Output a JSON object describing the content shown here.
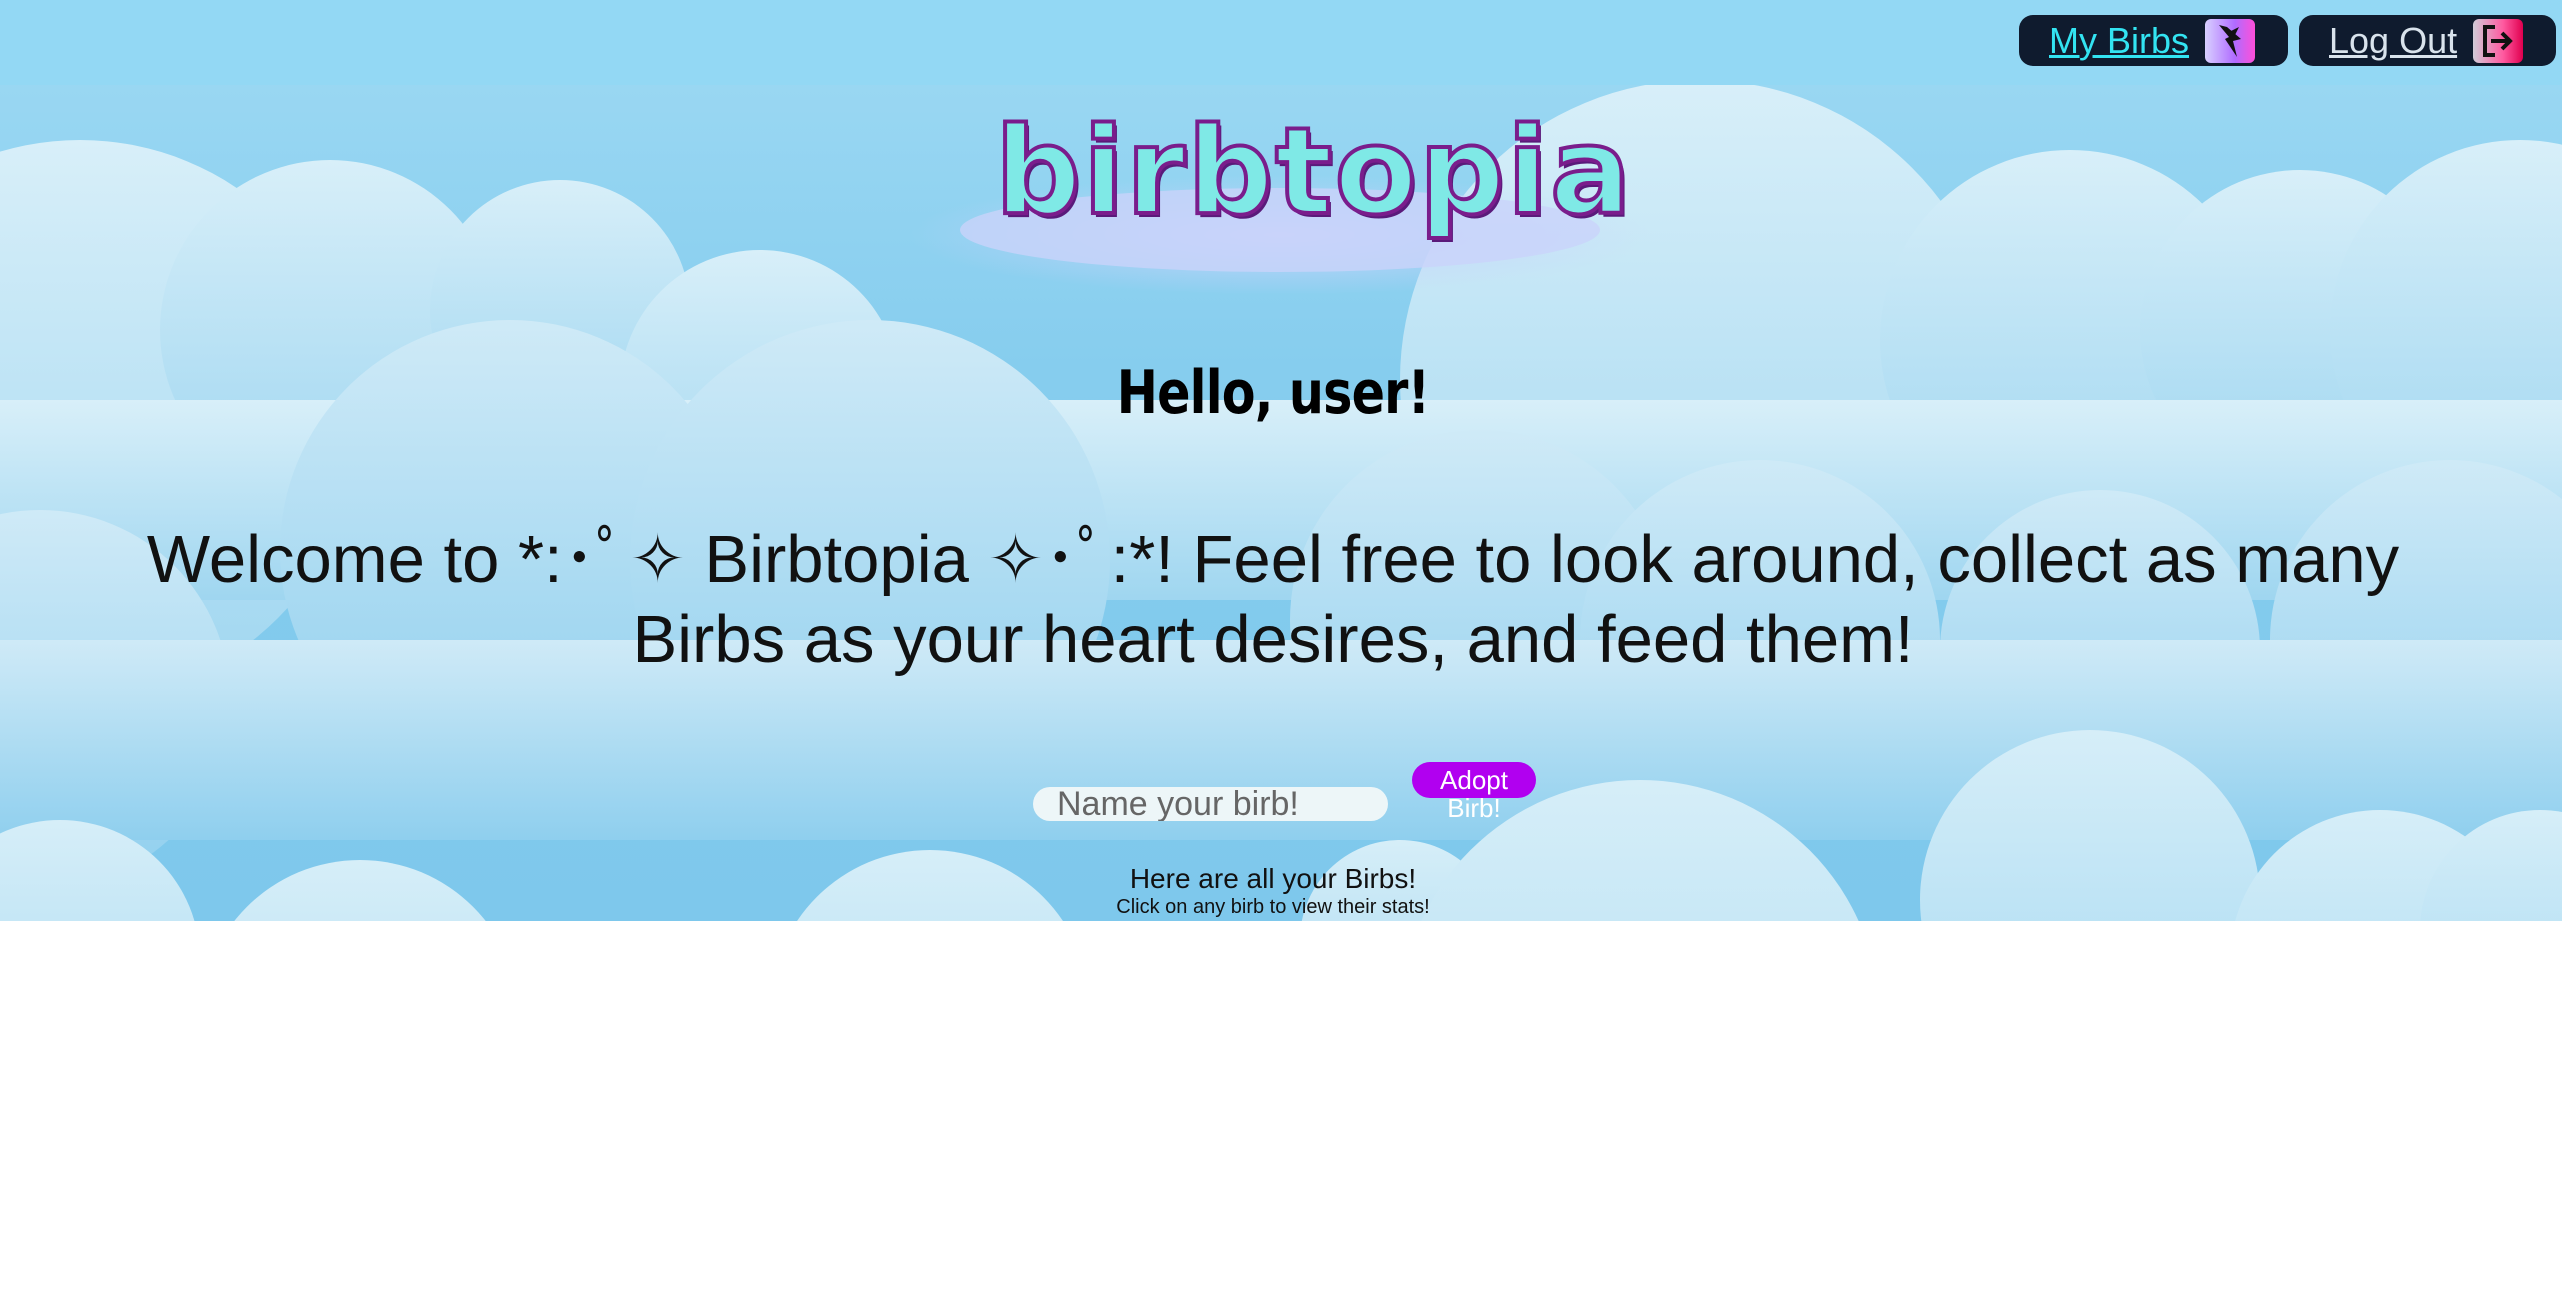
{
  "nav": {
    "my_birbs_label": "My Birbs",
    "log_out_label": "Log Out",
    "my_birbs_icon": "bird-icon",
    "log_out_icon": "logout-icon"
  },
  "logo": {
    "text": "birbtopia"
  },
  "greeting": "Hello, user!",
  "welcome": "Welcome to *:･ﾟ✧ Birbtopia ✧･ﾟ:*! Feel free to look around, collect as many Birbs as your heart desires, and feed them!",
  "adopt_form": {
    "name_placeholder": "Name your birb!",
    "adopt_label": "Adopt Birb!"
  },
  "birbs_list": {
    "title": "Here are all your Birbs!",
    "subtitle": "Click on any birb to view their stats!"
  },
  "colors": {
    "sky": "#86cdee",
    "cloud": "#c9e8f6",
    "nav_bg": "#0f1b2e",
    "link_cyan": "#33e4f2",
    "adopt_button": "#b100f0"
  }
}
